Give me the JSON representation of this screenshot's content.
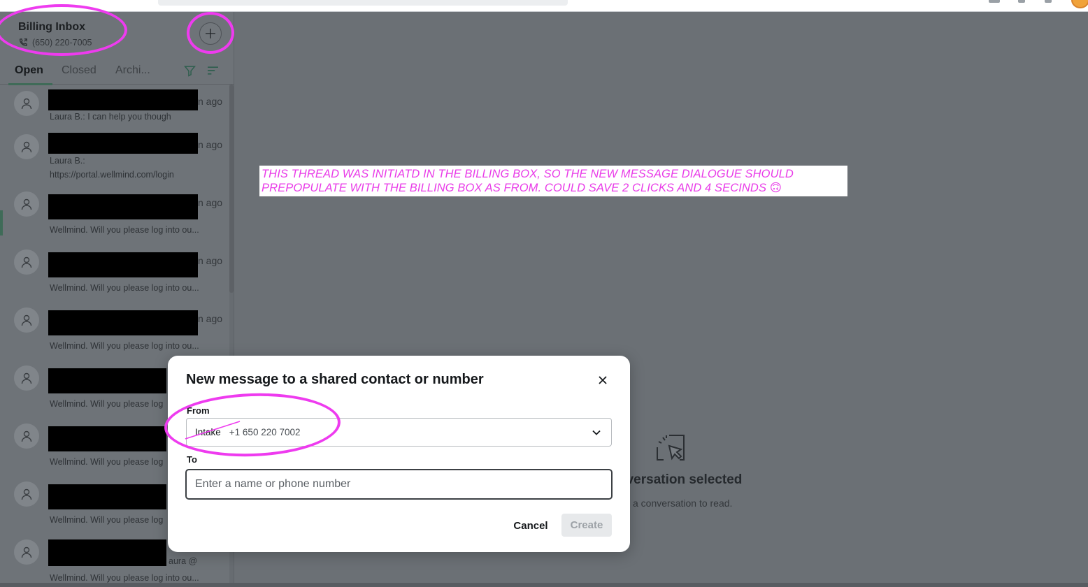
{
  "inbox": {
    "title": "Billing Inbox",
    "phone": "(650) 220-7005"
  },
  "tabs": {
    "open": "Open",
    "closed": "Closed",
    "archived": "Archi..."
  },
  "conversations": [
    {
      "time": "n ago",
      "snippet": "Laura B.: I can help you though"
    },
    {
      "time": "n ago",
      "snippet": "Laura B.: https://portal.wellmind.com/login"
    },
    {
      "time": "n ago",
      "snippet": "Wellmind. Will you please log into ou..."
    },
    {
      "time": "n ago",
      "snippet": "Wellmind. Will you please log into ou..."
    },
    {
      "time": "n ago",
      "snippet": "Wellmind. Will you please log into ou..."
    },
    {
      "time": "",
      "snippet": "Wellmind. Will you please log"
    },
    {
      "time": "",
      "snippet": "Wellmind. Will you please log"
    },
    {
      "time": "",
      "snippet": "Wellmind. Will you please log"
    },
    {
      "time": "aura @",
      "snippet": "Wellmind. Will you please log into ou..."
    }
  ],
  "empty_state": {
    "title": "nversation selected",
    "subtitle": "a conversation to read."
  },
  "annotation": {
    "note": "THIS THREAD WAS INITIATD IN THE BILLING BOX, SO THE NEW MESSAGE DIALOGUE SHOULD PREPOPULATE WITH THE BILLING BOX AS FROM. COULD SAVE 2 CLICKS AND 4 SECINDS 🙃",
    "color": "#ee3bef"
  },
  "modal": {
    "title": "New message to a shared contact or number",
    "from_label": "From",
    "from_name": "Intake",
    "from_number": "+1 650 220 7002",
    "to_label": "To",
    "to_placeholder": "Enter a name or phone number",
    "to_value": "",
    "cancel": "Cancel",
    "create": "Create"
  },
  "colors": {
    "accent": "#3f6b58",
    "overlay": "#6b7075"
  }
}
